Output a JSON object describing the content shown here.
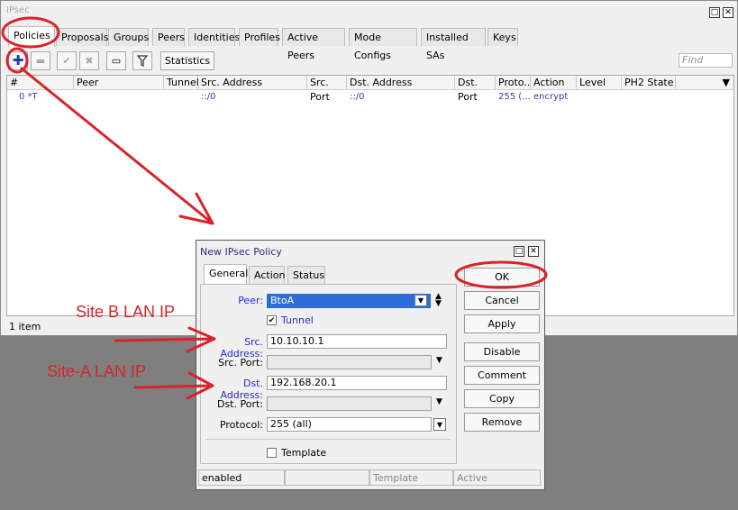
{
  "main_window": {
    "title": "IPsec",
    "tabs": [
      "Policies",
      "Proposals",
      "Groups",
      "Peers",
      "Identities",
      "Profiles",
      "Active Peers",
      "Mode Configs",
      "Installed SAs",
      "Keys"
    ],
    "toolbar": {
      "statistics_label": "Statistics",
      "find_placeholder": "Find"
    },
    "table": {
      "columns": [
        "#",
        "Peer",
        "Tunnel",
        "Src. Address",
        "Src. Port",
        "Dst. Address",
        "Dst. Port",
        "Proto...",
        "Action",
        "Level",
        "PH2 State"
      ],
      "rows": [
        {
          "num": "0 *T",
          "peer": "",
          "tunnel": "",
          "src_address": "::/0",
          "src_port": "",
          "dst_address": "::/0",
          "dst_port": "",
          "proto": "255 (...",
          "action": "encrypt",
          "level": "",
          "ph2_state": ""
        }
      ]
    },
    "status": "1 item"
  },
  "dialog": {
    "title": "New IPsec Policy",
    "tabs": [
      "General",
      "Action",
      "Status"
    ],
    "fields": {
      "peer_label": "Peer:",
      "peer_value": "BtoA",
      "tunnel_label": "Tunnel",
      "src_address_label": "Src. Address:",
      "src_address_value": "10.10.10.1",
      "src_port_label": "Src. Port:",
      "dst_address_label": "Dst. Address:",
      "dst_address_value": "192.168.20.1",
      "dst_port_label": "Dst. Port:",
      "protocol_label": "Protocol:",
      "protocol_value": "255 (all)",
      "template_label": "Template"
    },
    "buttons": [
      "OK",
      "Cancel",
      "Apply",
      "Disable",
      "Comment",
      "Copy",
      "Remove"
    ],
    "status": [
      "enabled",
      "",
      "Template",
      "Active"
    ]
  },
  "annotations": {
    "site_b": "Site B LAN IP",
    "site_a": "Site-A LAN IP",
    "color": "#d8232a"
  }
}
